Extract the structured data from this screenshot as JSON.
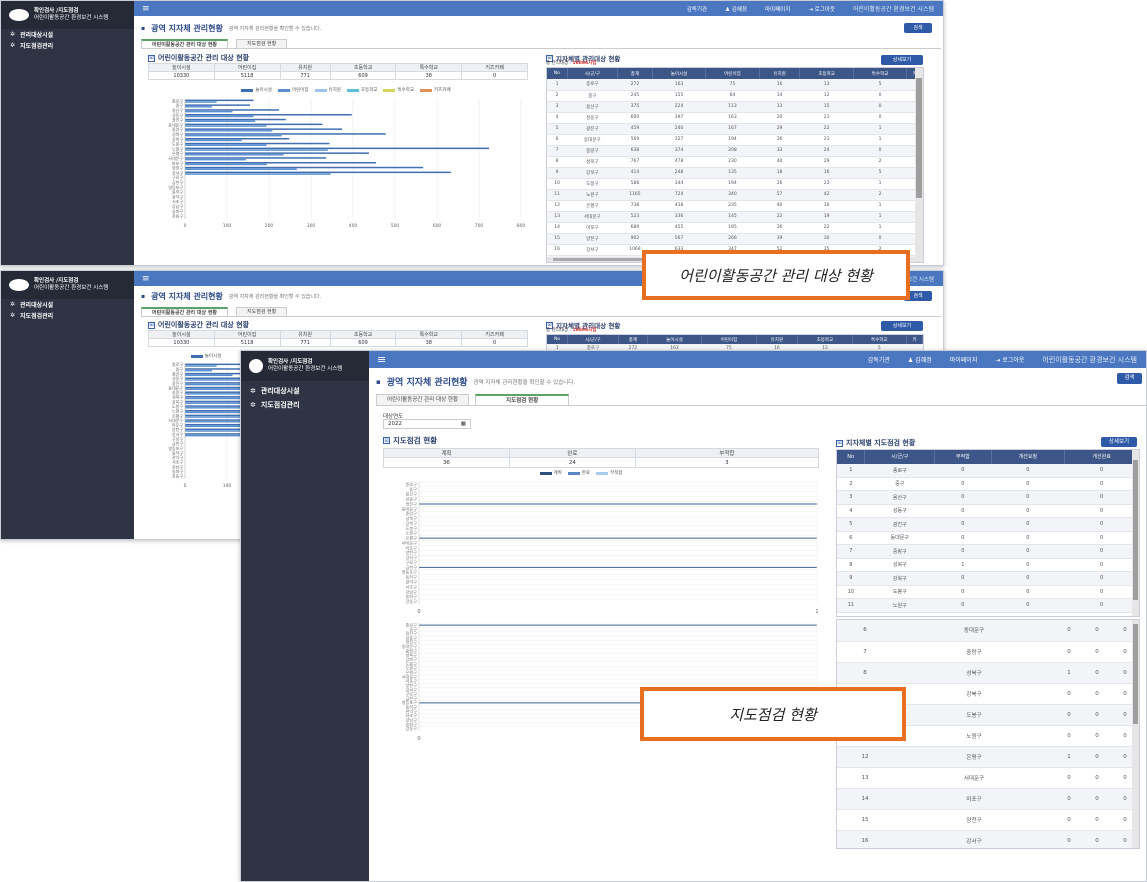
{
  "sidebar": {
    "logo_line1": "확인검사 /지도점검",
    "logo_line2": "어린이활동공간 환경보건 시스템",
    "menu": [
      {
        "label": "관리대상시설",
        "icon": "gear-icon"
      },
      {
        "label": "지도점검관리",
        "icon": "gear-icon"
      }
    ]
  },
  "topbar": {
    "menu_icon": "≡",
    "items": [
      "감독기관",
      "김혜정",
      "마이페이지",
      "로그아웃",
      "어린이활동공간 환경보건 시스템"
    ],
    "icons": {
      "user": "user-icon",
      "logout": "logout-icon"
    }
  },
  "page": {
    "title": "광역 지자체 관리현황",
    "desc": "광역 지자체 관리현황을 확인할 수 있습니다.",
    "search_button": "검색",
    "tabs": [
      "어린이활동공간 관리 대상 현황",
      "지도점검 현황"
    ]
  },
  "mgmt": {
    "section_title": "어린이활동공간 관리 대상 현황",
    "summary_headers": [
      "놀이시설",
      "어린이집",
      "유치원",
      "초등학교",
      "특수학교",
      "키즈카페"
    ],
    "summary_values": [
      "10330",
      "5118",
      "771",
      "609",
      "38",
      "0"
    ],
    "legend": [
      "놀이시설",
      "어린이집",
      "유치원",
      "초등학교",
      "특수학교",
      "키즈카페"
    ],
    "right_title": "지자체별 관리대상 현황",
    "total_label": "총 관리대상 : ",
    "total_value": "16866사업",
    "detail_button": "상세보기",
    "table_headers": [
      "No",
      "시/군/구",
      "총계",
      "놀이시설",
      "어린이집",
      "유치원",
      "초등학교",
      "특수학교",
      "키"
    ],
    "rows": [
      [
        "1",
        "종로구",
        "272",
        "163",
        "75",
        "16",
        "13",
        "5"
      ],
      [
        "2",
        "중구",
        "245",
        "155",
        "64",
        "14",
        "12",
        "0"
      ],
      [
        "3",
        "용산구",
        "375",
        "224",
        "113",
        "13",
        "15",
        "0"
      ],
      [
        "4",
        "성동구",
        "600",
        "397",
        "163",
        "20",
        "21",
        "0"
      ],
      [
        "5",
        "광진구",
        "459",
        "240",
        "167",
        "29",
        "22",
        "1"
      ],
      [
        "6",
        "동대문구",
        "569",
        "327",
        "194",
        "26",
        "21",
        "1"
      ],
      [
        "7",
        "중랑구",
        "638",
        "374",
        "208",
        "33",
        "24",
        "0"
      ],
      [
        "8",
        "성북구",
        "767",
        "478",
        "230",
        "40",
        "29",
        "2"
      ],
      [
        "9",
        "강북구",
        "414",
        "248",
        "135",
        "18",
        "16",
        "5"
      ],
      [
        "10",
        "도봉구",
        "588",
        "344",
        "194",
        "26",
        "23",
        "1"
      ],
      [
        "11",
        "노원구",
        "1165",
        "724",
        "340",
        "57",
        "42",
        "2"
      ],
      [
        "12",
        "은평구",
        "738",
        "438",
        "235",
        "40",
        "30",
        "1"
      ],
      [
        "13",
        "서대문구",
        "523",
        "336",
        "145",
        "22",
        "19",
        "1"
      ],
      [
        "14",
        "마포구",
        "689",
        "455",
        "195",
        "26",
        "22",
        "1"
      ],
      [
        "15",
        "양천구",
        "902",
        "567",
        "266",
        "39",
        "30",
        "0"
      ],
      [
        "16",
        "강서구",
        "1069",
        "633",
        "347",
        "52",
        "35",
        "2"
      ],
      [
        "17",
        "구로구",
        "",
        "",
        "",
        "",
        "",
        ""
      ]
    ],
    "chart_categories": [
      "종로구",
      "중구",
      "용산구",
      "성동구",
      "광진구",
      "동대문구",
      "중랑구",
      "성북구",
      "강북구",
      "도봉구",
      "노원구",
      "은평구",
      "서대문구",
      "마포구",
      "양천구",
      "강서구",
      "구로구",
      "금천구",
      "영등포구",
      "동작구",
      "관악구",
      "서초구",
      "강남구",
      "송파구",
      "강동구"
    ],
    "chart_ticks": [
      "0",
      "100",
      "200",
      "300",
      "400",
      "500",
      "600",
      "700",
      "800"
    ]
  },
  "insp": {
    "year_label": "대상연도",
    "year_value": "2022",
    "calendar_icon": "calendar-icon",
    "section_title": "지도점검 현황",
    "summary_headers": [
      "계획",
      "완료",
      "부적합"
    ],
    "summary_values": [
      "36",
      "24",
      "3"
    ],
    "legend": [
      "계획",
      "완료",
      "부적합"
    ],
    "right_title": "지자체별 지도점검 현황",
    "detail_button": "상세보기",
    "table_headers": [
      "No",
      "시/군/구",
      "부적합",
      "개선요청",
      "개선완료"
    ],
    "rows_top": [
      [
        "1",
        "종로구",
        "0",
        "0",
        "0"
      ],
      [
        "2",
        "중구",
        "0",
        "0",
        "0"
      ],
      [
        "3",
        "용산구",
        "0",
        "0",
        "0"
      ],
      [
        "4",
        "성동구",
        "0",
        "0",
        "0"
      ],
      [
        "5",
        "광진구",
        "0",
        "0",
        "0"
      ],
      [
        "6",
        "동대문구",
        "0",
        "0",
        "0"
      ],
      [
        "7",
        "중랑구",
        "0",
        "0",
        "0"
      ],
      [
        "8",
        "성북구",
        "1",
        "0",
        "0"
      ],
      [
        "9",
        "강북구",
        "0",
        "0",
        "0"
      ],
      [
        "10",
        "도봉구",
        "0",
        "0",
        "0"
      ],
      [
        "11",
        "노원구",
        "0",
        "0",
        "0"
      ]
    ],
    "rows_bottom": [
      [
        "6",
        "동대문구",
        "0",
        "0",
        "0"
      ],
      [
        "7",
        "중랑구",
        "0",
        "0",
        "0"
      ],
      [
        "8",
        "성북구",
        "1",
        "0",
        "0"
      ],
      [
        "9",
        "강북구",
        "0",
        "0",
        "0"
      ],
      [
        "10",
        "도봉구",
        "0",
        "0",
        "0"
      ],
      [
        "11",
        "노원구",
        "0",
        "0",
        "0"
      ],
      [
        "12",
        "은평구",
        "1",
        "0",
        "0"
      ],
      [
        "13",
        "서대문구",
        "0",
        "0",
        "0"
      ],
      [
        "14",
        "마포구",
        "0",
        "0",
        "0"
      ],
      [
        "15",
        "양천구",
        "0",
        "0",
        "0"
      ],
      [
        "16",
        "강서구",
        "0",
        "0",
        "0"
      ]
    ],
    "chart_categories": [
      "종로구",
      "중구",
      "용산구",
      "성동구",
      "광진구",
      "동대문구",
      "중랑구",
      "성북구",
      "강북구",
      "도봉구",
      "노원구",
      "은평구",
      "서대문구",
      "마포구",
      "양천구",
      "강서구",
      "구로구",
      "금천구",
      "영등포구",
      "동작구",
      "관악구",
      "서초구",
      "강남구",
      "송파구",
      "강동구"
    ],
    "chart_ticks": [
      "0",
      "1"
    ]
  },
  "callouts": {
    "mgmt": "어린이활동공간 관리 대상 현황",
    "insp": "지도점검 현황"
  },
  "chart_data": [
    {
      "type": "bar",
      "title": "어린이활동공간 관리 대상 현황",
      "orientation": "horizontal",
      "categories": [
        "종로구",
        "중구",
        "용산구",
        "성동구",
        "광진구",
        "동대문구",
        "중랑구",
        "성북구",
        "강북구",
        "도봉구",
        "노원구",
        "은평구",
        "서대문구",
        "마포구",
        "양천구",
        "강서구"
      ],
      "series": [
        {
          "name": "놀이시설",
          "values": [
            163,
            155,
            224,
            397,
            240,
            327,
            374,
            478,
            248,
            344,
            724,
            438,
            336,
            455,
            567,
            633
          ]
        },
        {
          "name": "어린이집",
          "values": [
            75,
            64,
            113,
            163,
            167,
            194,
            208,
            230,
            135,
            194,
            340,
            235,
            145,
            195,
            266,
            347
          ]
        }
      ],
      "xlim": [
        0,
        800
      ]
    },
    {
      "type": "bar",
      "title": "지도점검 현황",
      "orientation": "horizontal",
      "series": [
        {
          "name": "계획",
          "values": []
        },
        {
          "name": "완료",
          "values": []
        },
        {
          "name": "부적합",
          "values": []
        }
      ],
      "xlim": [
        0,
        1
      ]
    }
  ],
  "colors": {
    "sidebar": "#2f3444",
    "topbar": "#4a77bf",
    "table_head": "#3d5688",
    "callout": "#e76f1f",
    "series": [
      "#3f6fb0",
      "#5b8fd0",
      "#9cc3ea",
      "#5bc0de",
      "#d4d45a",
      "#e0915a"
    ],
    "insp_series": [
      "#2f4f7f",
      "#5a86c4",
      "#a9cbee"
    ]
  }
}
